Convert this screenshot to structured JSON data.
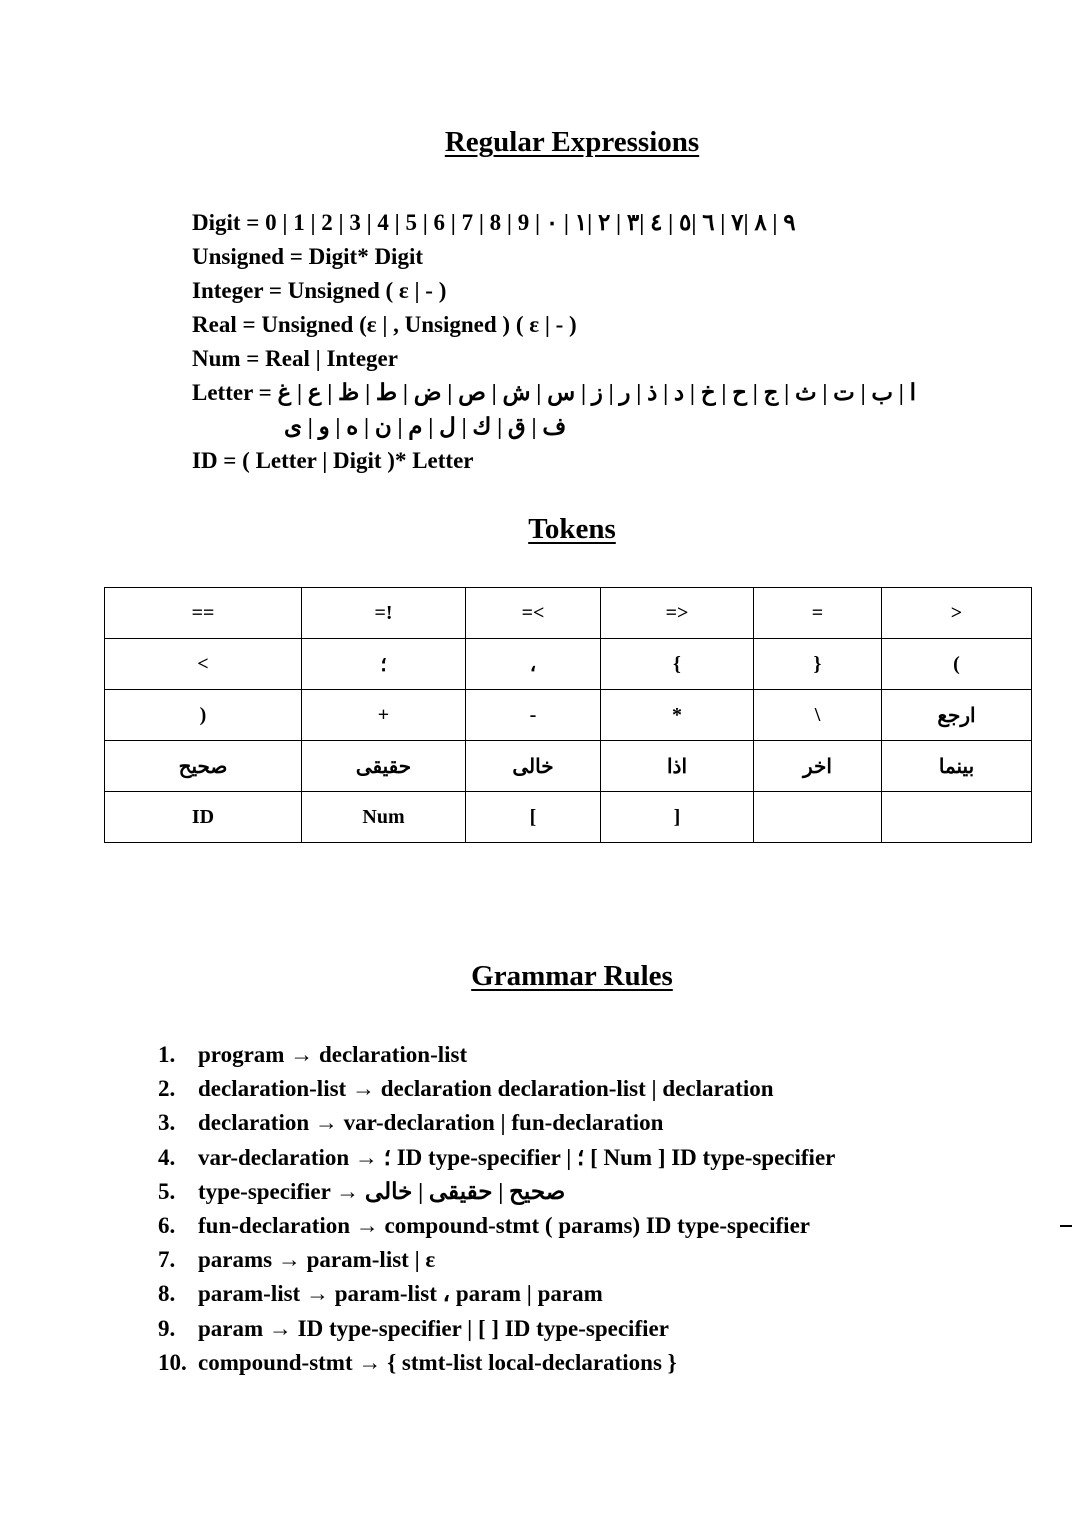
{
  "sections": {
    "regex_heading": "Regular Expressions",
    "tokens_heading": "Tokens",
    "grammar_heading": "Grammar Rules"
  },
  "regex": {
    "digit": "Digit = 0 | 1 | 2 | 3 | 4 | 5 | 6 | 7 | 8 | 9 | ٩ | ٨ |٧ | ٦ |٥ | ٤ |٣ | ٢ |١ | ٠",
    "unsigned": "Unsigned = Digit* Digit",
    "integer": "Integer = Unsigned ( ε | - )",
    "real": "Real = Unsigned (ε | , Unsigned ) ( ε | - )",
    "num": "Num = Real | Integer",
    "letter_label": "Letter =",
    "letter_line1": "ا | ب | ت | ث | ج | ح | خ | د | ذ | ر | ز | س | ش | ص | ض | ط | ظ | ع | غ",
    "letter_line2": "ف | ق | ك | ل | م | ن | ه | و | ى",
    "id": "ID = ( Letter | Digit )* Letter"
  },
  "tokens": {
    "rows": [
      [
        "==",
        "=!",
        "=<",
        "=>",
        "=",
        ">"
      ],
      [
        "<",
        "؛",
        "،",
        "{",
        "}",
        "("
      ],
      [
        ")",
        "+",
        "-",
        "*",
        "\\",
        "ارجع"
      ],
      [
        "صحيح",
        "حقيقى",
        "خالى",
        "اذا",
        "اخر",
        "بينما"
      ],
      [
        "ID",
        "Num",
        "[",
        "]",
        "",
        ""
      ]
    ]
  },
  "grammar": {
    "rules": [
      {
        "num": "1.",
        "text": "program → declaration-list"
      },
      {
        "num": "2.",
        "text": "declaration-list → declaration declaration-list | declaration"
      },
      {
        "num": "3.",
        "text": "declaration → var-declaration | fun-declaration"
      },
      {
        "num": "4.",
        "text": "var-declaration → ؛ ID type-specifier | ؛ [ Num ] ID type-specifier"
      },
      {
        "num": "5.",
        "text_prefix": "type-specifier →",
        "text_rtl": "صحيح | حقيقى | خالى"
      },
      {
        "num": "6.",
        "text": "fun-declaration → compound-stmt ( params) ID type-specifier"
      },
      {
        "num": "7.",
        "text": "params → param-list | ε"
      },
      {
        "num": "8.",
        "text": "param-list → param-list ، param | param"
      },
      {
        "num": "9.",
        "text": "param → ID type-specifier | [ ] ID type-specifier"
      },
      {
        "num": "10.",
        "text": "compound-stmt → { stmt-list local-declarations }"
      }
    ]
  }
}
